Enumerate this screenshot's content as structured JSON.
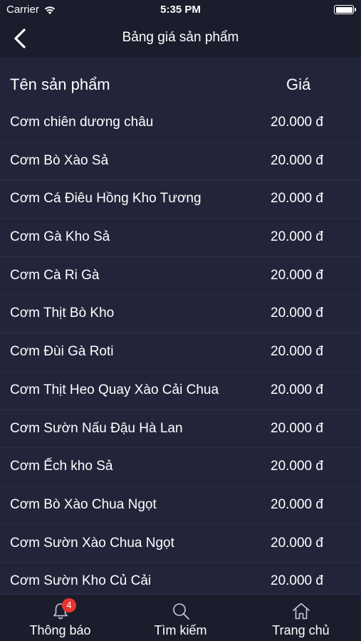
{
  "status_bar": {
    "carrier": "Carrier",
    "time": "5:35 PM"
  },
  "nav": {
    "title": "Bảng giá sản phẩm"
  },
  "table": {
    "headers": {
      "name": "Tên sản phẩm",
      "price": "Giá"
    },
    "rows": [
      {
        "name": "Cơm chiên dương châu",
        "price": "20.000 đ"
      },
      {
        "name": "Cơm Bò Xào Sả",
        "price": "20.000 đ"
      },
      {
        "name": "Cơm Cá Điêu Hồng Kho Tương",
        "price": "20.000 đ"
      },
      {
        "name": "Cơm Gà Kho Sả",
        "price": "20.000 đ"
      },
      {
        "name": "Cơm Cà Ri Gà",
        "price": "20.000 đ"
      },
      {
        "name": "Cơm Thịt Bò Kho",
        "price": "20.000 đ"
      },
      {
        "name": "Cơm Đùi Gà Roti",
        "price": "20.000 đ"
      },
      {
        "name": "Cơm Thịt Heo Quay Xào Cải Chua",
        "price": "20.000 đ"
      },
      {
        "name": "Cơm Sườn Nấu Đậu Hà Lan",
        "price": "20.000 đ"
      },
      {
        "name": "Cơm Ếch kho Sả",
        "price": "20.000 đ"
      },
      {
        "name": "Cơm Bò Xào Chua Ngọt",
        "price": "20.000 đ"
      },
      {
        "name": "Cơm Sườn Xào Chua Ngọt",
        "price": "20.000 đ"
      },
      {
        "name": "Cơm Sườn Kho Củ Cải",
        "price": "20.000 đ"
      }
    ]
  },
  "tab_bar": {
    "tabs": [
      {
        "label": "Thông báo",
        "icon": "bell-icon",
        "badge": "4"
      },
      {
        "label": "Tìm kiếm",
        "icon": "search-icon"
      },
      {
        "label": "Trang chủ",
        "icon": "home-icon"
      }
    ]
  },
  "colors": {
    "background": "#22253a",
    "bar": "#1b1d2c",
    "badge": "#e8352f"
  }
}
